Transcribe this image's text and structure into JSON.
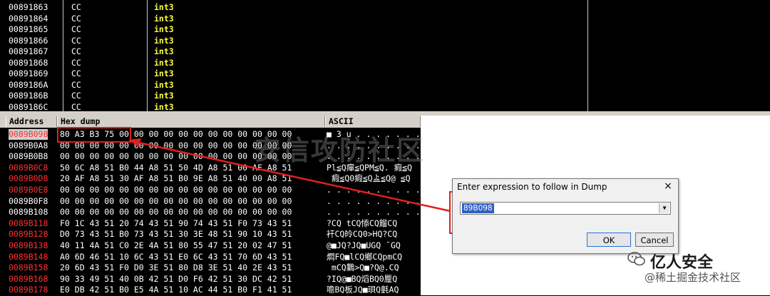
{
  "disasm": {
    "rows": [
      {
        "addr": "00891863",
        "hex": "CC",
        "cmd": "int3"
      },
      {
        "addr": "00891864",
        "hex": "CC",
        "cmd": "int3"
      },
      {
        "addr": "00891865",
        "hex": "CC",
        "cmd": "int3"
      },
      {
        "addr": "00891866",
        "hex": "CC",
        "cmd": "int3"
      },
      {
        "addr": "00891867",
        "hex": "CC",
        "cmd": "int3"
      },
      {
        "addr": "00891868",
        "hex": "CC",
        "cmd": "int3"
      },
      {
        "addr": "00891869",
        "hex": "CC",
        "cmd": "int3"
      },
      {
        "addr": "0089186A",
        "hex": "CC",
        "cmd": "int3"
      },
      {
        "addr": "0089186B",
        "hex": "CC",
        "cmd": "int3"
      },
      {
        "addr": "0089186C",
        "hex": "CC",
        "cmd": "int3"
      }
    ]
  },
  "dump": {
    "headers": {
      "address": "Address",
      "hex": "Hex dump",
      "ascii": "ASCII"
    },
    "rows": [
      {
        "addr": "0089B098",
        "red": true,
        "hex": "80 A3 B3 75 00 00 00 00 00 00 00 00 00 00 00 00",
        "ascii": "■ 3 u . . . . . . . . . . . ."
      },
      {
        "addr": "0089B0A8",
        "red": false,
        "hex": "00 00 00 00 00 00 00 00 00 00 00 00 00 00 00 00",
        "ascii": ". . . . . . . . . . . . . . . ."
      },
      {
        "addr": "0089B0B8",
        "red": false,
        "hex": "00 00 00 00 00 00 00 00 00 00 00 00 00 00 00 00",
        "ascii": ". . . . . . . . . . . . . . . ."
      },
      {
        "addr": "0089B0C8",
        "red": true,
        "hex": "50 6C A8 51 B0 44 A8 51 50 4D A8 51 00 AF A8 51",
        "ascii": "Pl≦Q癉≦QPM≦Q. 瘕≦Q"
      },
      {
        "addr": "0089B0D8",
        "red": true,
        "hex": "20 AF A8 51 30 AF A8 51 B0 9E A8 51 40 00 A8 51",
        "ascii": " 瘕≦Q0瘕≦Q盀≦Q@ ≦Q"
      },
      {
        "addr": "0089B0E8",
        "red": true,
        "hex": "00 00 00 00 00 00 00 00 00 00 00 00 00 00 00 00",
        "ascii": ". . . . . . . . . . . . . . . ."
      },
      {
        "addr": "0089B0F8",
        "red": false,
        "hex": "00 00 00 00 00 00 00 00 00 00 00 00 00 00 00 00",
        "ascii": ". . . . . . . . . . . . . . . ."
      },
      {
        "addr": "0089B108",
        "red": false,
        "hex": "00 00 00 00 00 00 00 00 00 00 00 00 00 00 00 00",
        "ascii": ". . . . . . . . . . . . . . . ."
      },
      {
        "addr": "0089B118",
        "red": true,
        "hex": "F0 1C 43 51 20 74 43 51 90 74 43 51 F0 73 43 51",
        "ascii": "?CQ tCQ悿CQ餾CQ"
      },
      {
        "addr": "0089B128",
        "red": true,
        "hex": "D0 73 43 51 B0 73 43 51 30 3E 48 51 90 10 43 51",
        "ascii": "衦CQ皊CQ0>HQ?CQ"
      },
      {
        "addr": "0089B138",
        "red": true,
        "hex": "40 11 4A 51 C0 2E 4A 51 80 55 47 51 20 02 47 51",
        "ascii": "@■JQ?JQ■UGQ ¯GQ"
      },
      {
        "addr": "0089B148",
        "red": true,
        "hex": "A0 6D 46 51 10 6C 43 51 E0 6C 43 51 70 6D 43 51",
        "ascii": "燜FQ■lCQ鄉CQpmCQ"
      },
      {
        "addr": "0089B158",
        "red": true,
        "hex": "20 6D 43 51 F0 D0 3E 51 80 D8 3E 51 40 2E 43 51",
        "ascii": " mCQ鸈>Q■?Q@.CQ"
      },
      {
        "addr": "0089B168",
        "red": true,
        "hex": "90 33 49 51 40 0B 42 51 D0 F6 42 51 30 DC 42 51",
        "ascii": "?IQ@■BQ熖BQ0蹷Q"
      },
      {
        "addr": "0089B178",
        "red": true,
        "hex": "E0 DB 42 51 B0 E5 4A 51 10 AC 44 51 B0 F1 41 51",
        "ascii": "噡BQ板JQ■珼Q氃AQ"
      }
    ]
  },
  "dialog": {
    "title": "Enter expression to follow in Dump",
    "close": "×",
    "input_value": "89B098",
    "ok": "OK",
    "cancel": "Cancel"
  },
  "overlay": {
    "watermark": "安信攻防社区",
    "brand": "亿人安全",
    "brand_sub": "@稀土掘金技术社区"
  },
  "colors": {
    "annotation_red": "#e02020",
    "instruction_yellow": "#ffff40",
    "address_red": "#ff3030"
  }
}
